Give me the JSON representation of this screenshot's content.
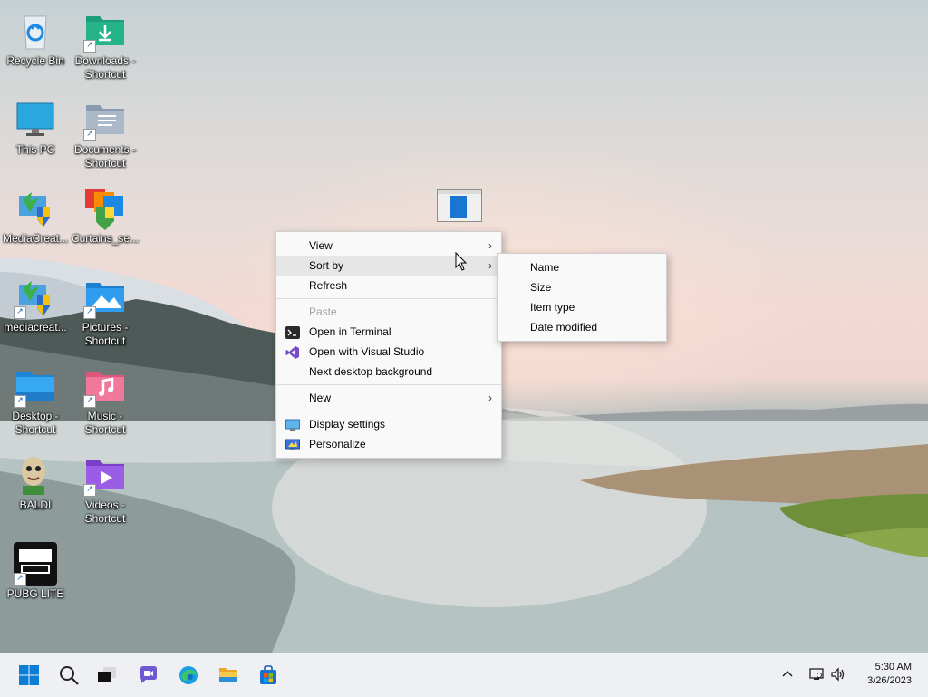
{
  "desktop": {
    "icons": [
      {
        "label": "Recycle Bin",
        "icon": "recycle-bin-icon",
        "shortcut": false
      },
      {
        "label": "Downloads - Shortcut",
        "icon": "downloads-folder-icon",
        "shortcut": true
      },
      {
        "label": "This PC",
        "icon": "this-pc-icon",
        "shortcut": false
      },
      {
        "label": "Documents - Shortcut",
        "icon": "documents-folder-icon",
        "shortcut": true
      },
      {
        "label": "MediaCreat...",
        "icon": "media-creation-tool-icon",
        "shortcut": false
      },
      {
        "label": "Curtains_se...",
        "icon": "curtains-app-icon",
        "shortcut": false
      },
      {
        "label": "mediacreat...",
        "icon": "media-creation-tool-icon",
        "shortcut": true
      },
      {
        "label": "Pictures - Shortcut",
        "icon": "pictures-folder-icon",
        "shortcut": true
      },
      {
        "label": "Desktop - Shortcut",
        "icon": "desktop-folder-icon",
        "shortcut": true
      },
      {
        "label": "Music - Shortcut",
        "icon": "music-folder-icon",
        "shortcut": true
      },
      {
        "label": "BALDI",
        "icon": "baldi-game-icon",
        "shortcut": false
      },
      {
        "label": "Videos - Shortcut",
        "icon": "videos-folder-icon",
        "shortcut": true
      },
      {
        "label": "PUBG LITE",
        "icon": "pubg-lite-icon",
        "shortcut": true
      }
    ]
  },
  "context_menu": {
    "view": "View",
    "sort_by": "Sort by",
    "refresh": "Refresh",
    "paste": "Paste",
    "open_terminal": "Open in Terminal",
    "open_vs": "Open with Visual Studio",
    "next_bg": "Next desktop background",
    "new": "New",
    "display_settings": "Display settings",
    "personalize": "Personalize",
    "chevron": "›"
  },
  "sort_submenu": {
    "items": [
      "Name",
      "Size",
      "Item type",
      "Date modified"
    ]
  },
  "taskbar": {
    "time": "5:30 AM",
    "date": "3/26/2023",
    "apps": [
      "start-icon",
      "search-icon",
      "task-view-icon",
      "chat-icon",
      "edge-icon",
      "file-explorer-icon",
      "store-icon"
    ]
  },
  "colors": {
    "accent": "#0067c0",
    "menu_bg": "#f9f9f9",
    "taskbar_bg": "#eef0f3"
  }
}
